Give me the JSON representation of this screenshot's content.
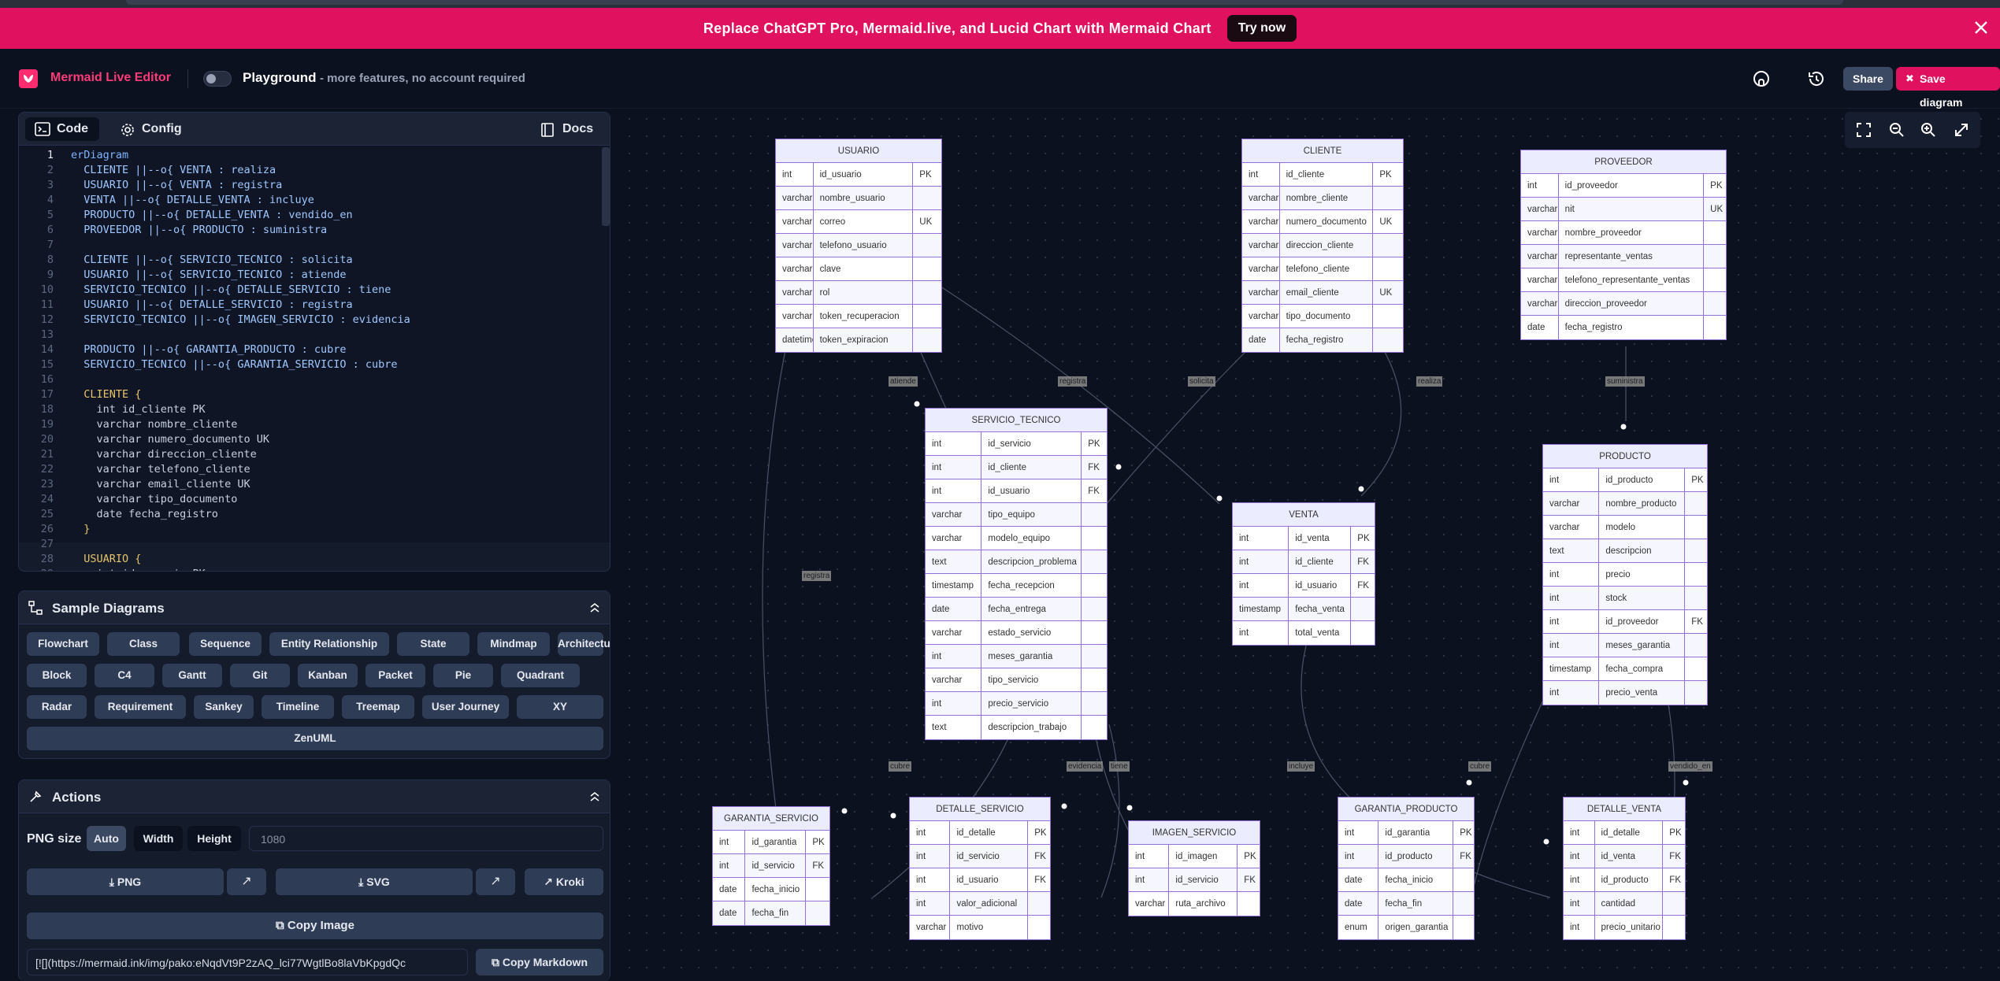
{
  "banner": {
    "text": "Replace ChatGPT Pro, Mermaid.live, and Lucid Chart with Mermaid Chart",
    "button": "Try now"
  },
  "header": {
    "brand": "Mermaid Live Editor",
    "playground": "Playground",
    "playground_sub": "- more features, no account required",
    "share": "Share",
    "save": "Save diagram"
  },
  "editor": {
    "tabs": [
      "Code",
      "Config"
    ],
    "docs": "Docs",
    "lines": [
      "erDiagram",
      "  CLIENTE ||--o{ VENTA : realiza",
      "  USUARIO ||--o{ VENTA : registra",
      "  VENTA ||--o{ DETALLE_VENTA : incluye",
      "  PRODUCTO ||--o{ DETALLE_VENTA : vendido_en",
      "  PROVEEDOR ||--o{ PRODUCTO : suministra",
      "",
      "  CLIENTE ||--o{ SERVICIO_TECNICO : solicita",
      "  USUARIO ||--o{ SERVICIO_TECNICO : atiende",
      "  SERVICIO_TECNICO ||--o{ DETALLE_SERVICIO : tiene",
      "  USUARIO ||--o{ DETALLE_SERVICIO : registra",
      "  SERVICIO_TECNICO ||--o{ IMAGEN_SERVICIO : evidencia",
      "",
      "  PRODUCTO ||--o{ GARANTIA_PRODUCTO : cubre",
      "  SERVICIO_TECNICO ||--o{ GARANTIA_SERVICIO : cubre",
      "",
      "  CLIENTE {",
      "    int id_cliente PK",
      "    varchar nombre_cliente",
      "    varchar numero_documento UK",
      "    varchar direccion_cliente",
      "    varchar telefono_cliente",
      "    varchar email_cliente UK",
      "    varchar tipo_documento",
      "    date fecha_registro",
      "  }",
      "",
      "  USUARIO {",
      "    int id_usuario PK"
    ]
  },
  "samples": {
    "title": "Sample Diagrams",
    "items": [
      "Flowchart",
      "Class",
      "Sequence",
      "Entity Relationship",
      "State",
      "Mindmap",
      "Architecture",
      "Block",
      "C4",
      "Gantt",
      "Git",
      "Kanban",
      "Packet",
      "Pie",
      "Quadrant",
      "Radar",
      "Requirement",
      "Sankey",
      "Timeline",
      "Treemap",
      "User Journey",
      "XY",
      "ZenUML"
    ]
  },
  "actions": {
    "title": "Actions",
    "png_size_label": "PNG size",
    "size_options": [
      "Auto",
      "Width",
      "Height"
    ],
    "size_value": "1080",
    "png": "PNG",
    "svg": "SVG",
    "kroki": "Kroki",
    "copy_image": "Copy Image",
    "markdown_value": "[![](https://mermaid.ink/img/pako:eNqdVt9P2zAQ_lci77WgtlBo8laVbKpgdQc",
    "copy_markdown": "Copy Markdown"
  },
  "entities": [
    {
      "name": "USUARIO",
      "rows": [
        [
          "int",
          "id_usuario",
          "PK"
        ],
        [
          "varchar",
          "nombre_usuario",
          ""
        ],
        [
          "varchar",
          "correo",
          "UK"
        ],
        [
          "varchar",
          "telefono_usuario",
          ""
        ],
        [
          "varchar",
          "clave",
          ""
        ],
        [
          "varchar",
          "rol",
          ""
        ],
        [
          "varchar",
          "token_recuperacion",
          ""
        ],
        [
          "datetime",
          "token_expiracion",
          ""
        ]
      ]
    },
    {
      "name": "CLIENTE",
      "rows": [
        [
          "int",
          "id_cliente",
          "PK"
        ],
        [
          "varchar",
          "nombre_cliente",
          ""
        ],
        [
          "varchar",
          "numero_documento",
          "UK"
        ],
        [
          "varchar",
          "direccion_cliente",
          ""
        ],
        [
          "varchar",
          "telefono_cliente",
          ""
        ],
        [
          "varchar",
          "email_cliente",
          "UK"
        ],
        [
          "varchar",
          "tipo_documento",
          ""
        ],
        [
          "date",
          "fecha_registro",
          ""
        ]
      ]
    },
    {
      "name": "PROVEEDOR",
      "rows": [
        [
          "int",
          "id_proveedor",
          "PK"
        ],
        [
          "varchar",
          "nit",
          "UK"
        ],
        [
          "varchar",
          "nombre_proveedor",
          ""
        ],
        [
          "varchar",
          "representante_ventas",
          ""
        ],
        [
          "varchar",
          "telefono_representante_ventas",
          ""
        ],
        [
          "varchar",
          "direccion_proveedor",
          ""
        ],
        [
          "date",
          "fecha_registro",
          ""
        ]
      ]
    },
    {
      "name": "SERVICIO_TECNICO",
      "rows": [
        [
          "int",
          "id_servicio",
          "PK"
        ],
        [
          "int",
          "id_cliente",
          "FK"
        ],
        [
          "int",
          "id_usuario",
          "FK"
        ],
        [
          "varchar",
          "tipo_equipo",
          ""
        ],
        [
          "varchar",
          "modelo_equipo",
          ""
        ],
        [
          "text",
          "descripcion_problema",
          ""
        ],
        [
          "timestamp",
          "fecha_recepcion",
          ""
        ],
        [
          "date",
          "fecha_entrega",
          ""
        ],
        [
          "varchar",
          "estado_servicio",
          ""
        ],
        [
          "int",
          "meses_garantia",
          ""
        ],
        [
          "varchar",
          "tipo_servicio",
          ""
        ],
        [
          "int",
          "precio_servicio",
          ""
        ],
        [
          "text",
          "descripcion_trabajo",
          ""
        ]
      ]
    },
    {
      "name": "VENTA",
      "rows": [
        [
          "int",
          "id_venta",
          "PK"
        ],
        [
          "int",
          "id_cliente",
          "FK"
        ],
        [
          "int",
          "id_usuario",
          "FK"
        ],
        [
          "timestamp",
          "fecha_venta",
          ""
        ],
        [
          "int",
          "total_venta",
          ""
        ]
      ]
    },
    {
      "name": "PRODUCTO",
      "rows": [
        [
          "int",
          "id_producto",
          "PK"
        ],
        [
          "varchar",
          "nombre_producto",
          ""
        ],
        [
          "varchar",
          "modelo",
          ""
        ],
        [
          "text",
          "descripcion",
          ""
        ],
        [
          "int",
          "precio",
          ""
        ],
        [
          "int",
          "stock",
          ""
        ],
        [
          "int",
          "id_proveedor",
          "FK"
        ],
        [
          "int",
          "meses_garantia",
          ""
        ],
        [
          "timestamp",
          "fecha_compra",
          ""
        ],
        [
          "int",
          "precio_venta",
          ""
        ]
      ]
    },
    {
      "name": "GARANTIA_SERVICIO",
      "rows": [
        [
          "int",
          "id_garantia",
          "PK"
        ],
        [
          "int",
          "id_servicio",
          "FK"
        ],
        [
          "date",
          "fecha_inicio",
          ""
        ],
        [
          "date",
          "fecha_fin",
          ""
        ]
      ]
    },
    {
      "name": "DETALLE_SERVICIO",
      "rows": [
        [
          "int",
          "id_detalle",
          "PK"
        ],
        [
          "int",
          "id_servicio",
          "FK"
        ],
        [
          "int",
          "id_usuario",
          "FK"
        ],
        [
          "int",
          "valor_adicional",
          ""
        ],
        [
          "varchar",
          "motivo",
          ""
        ]
      ]
    },
    {
      "name": "IMAGEN_SERVICIO",
      "rows": [
        [
          "int",
          "id_imagen",
          "PK"
        ],
        [
          "int",
          "id_servicio",
          "FK"
        ],
        [
          "varchar",
          "ruta_archivo",
          ""
        ]
      ]
    },
    {
      "name": "GARANTIA_PRODUCTO",
      "rows": [
        [
          "int",
          "id_garantia",
          "PK"
        ],
        [
          "int",
          "id_producto",
          "FK"
        ],
        [
          "date",
          "fecha_inicio",
          ""
        ],
        [
          "date",
          "fecha_fin",
          ""
        ],
        [
          "enum",
          "origen_garantia",
          ""
        ]
      ]
    },
    {
      "name": "DETALLE_VENTA",
      "rows": [
        [
          "int",
          "id_detalle",
          "PK"
        ],
        [
          "int",
          "id_venta",
          "FK"
        ],
        [
          "int",
          "id_producto",
          "FK"
        ],
        [
          "int",
          "cantidad",
          ""
        ],
        [
          "int",
          "precio_unitario",
          ""
        ]
      ]
    }
  ],
  "relation_labels": [
    "atiende",
    "registra",
    "solicita",
    "realiza",
    "suministra",
    "registra",
    "cubre",
    "evidencia",
    "tiene",
    "incluye",
    "cubre",
    "vendido_en"
  ],
  "colors": {
    "accent": "#e0115f",
    "entity_fill": "#ececff",
    "entity_border": "#9370db"
  }
}
